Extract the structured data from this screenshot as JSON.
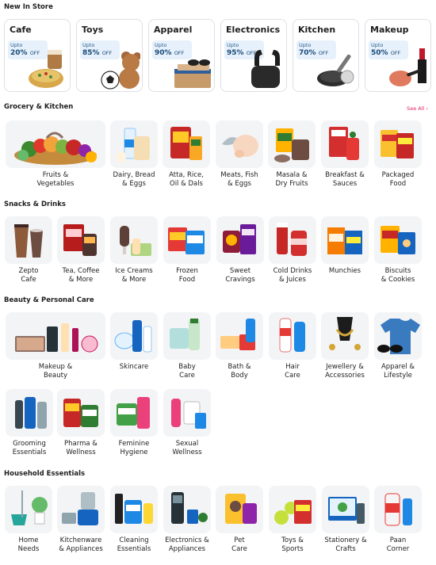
{
  "new_in_store": {
    "title": "New In Store",
    "cards": [
      {
        "name": "Cafe",
        "upto": "Upto",
        "percent": "20%",
        "off": "OFF",
        "icon": "cafe-food-icon"
      },
      {
        "name": "Toys",
        "upto": "Upto",
        "percent": "85%",
        "off": "OFF",
        "icon": "teddy-bear-icon"
      },
      {
        "name": "Apparel",
        "upto": "Upto",
        "percent": "90%",
        "off": "OFF",
        "icon": "clothes-sunglasses-icon"
      },
      {
        "name": "Electronics",
        "upto": "Upto",
        "percent": "95%",
        "off": "OFF",
        "icon": "earbuds-icon"
      },
      {
        "name": "Kitchen",
        "upto": "Upto",
        "percent": "70%",
        "off": "OFF",
        "icon": "pan-icon"
      },
      {
        "name": "Makeup",
        "upto": "Upto",
        "percent": "50%",
        "off": "OFF",
        "icon": "lipstick-icon"
      }
    ]
  },
  "grocery": {
    "title": "Grocery & Kitchen",
    "see_all": "See All ›",
    "items": [
      {
        "label": "Fruits &\nVegetables",
        "icon": "fruits-vegetables-icon"
      },
      {
        "label": "Dairy, Bread\n& Eggs",
        "icon": "dairy-icon"
      },
      {
        "label": "Atta, Rice,\nOil & Dals",
        "icon": "atta-icon"
      },
      {
        "label": "Meats, Fish\n& Eggs",
        "icon": "chicken-icon"
      },
      {
        "label": "Masala &\nDry Fruits",
        "icon": "masala-icon"
      },
      {
        "label": "Breakfast &\nSauces",
        "icon": "cereal-icon"
      },
      {
        "label": "Packaged\nFood",
        "icon": "noodles-icon"
      }
    ]
  },
  "snacks": {
    "title": "Snacks & Drinks",
    "items": [
      {
        "label": "Zepto\nCafe",
        "icon": "coffee-cup-icon"
      },
      {
        "label": "Tea, Coffee\n& More",
        "icon": "tea-box-icon"
      },
      {
        "label": "Ice Creams\n& More",
        "icon": "ice-cream-icon"
      },
      {
        "label": "Frozen\nFood",
        "icon": "frozen-food-icon"
      },
      {
        "label": "Sweet\nCravings",
        "icon": "chocolate-icon"
      },
      {
        "label": "Cold Drinks\n& Juices",
        "icon": "soda-can-icon"
      },
      {
        "label": "Munchies",
        "icon": "chips-icon"
      },
      {
        "label": "Biscuits\n& Cookies",
        "icon": "biscuits-icon"
      }
    ]
  },
  "beauty": {
    "title": "Beauty & Personal Care",
    "items": [
      {
        "label": "Makeup &\nBeauty",
        "icon": "makeup-palette-icon"
      },
      {
        "label": "Skincare",
        "icon": "skincare-bottle-icon"
      },
      {
        "label": "Baby\nCare",
        "icon": "baby-care-icon"
      },
      {
        "label": "Bath &\nBody",
        "icon": "soap-icon"
      },
      {
        "label": "Hair\nCare",
        "icon": "shampoo-icon"
      },
      {
        "label": "Jewellery &\nAccessories",
        "icon": "necklace-icon"
      },
      {
        "label": "Apparel &\nLifestyle",
        "icon": "tshirt-icon"
      },
      {
        "label": "Grooming\nEssentials",
        "icon": "razor-icon"
      },
      {
        "label": "Pharma &\nWellness",
        "icon": "medicine-icon"
      },
      {
        "label": "Feminine\nHygiene",
        "icon": "pads-icon"
      },
      {
        "label": "Sexual\nWellness",
        "icon": "wellness-icon"
      }
    ]
  },
  "household": {
    "title": "Household Essentials",
    "items": [
      {
        "label": "Home\nNeeds",
        "icon": "mop-bucket-icon"
      },
      {
        "label": "Kitchenware\n& Appliances",
        "icon": "mixer-icon"
      },
      {
        "label": "Cleaning\nEssentials",
        "icon": "detergent-icon"
      },
      {
        "label": "Electronics &\nAppliances",
        "icon": "appliance-icon"
      },
      {
        "label": "Pet\nCare",
        "icon": "pet-food-icon"
      },
      {
        "label": "Toys &\nSports",
        "icon": "ball-cards-icon"
      },
      {
        "label": "Stationery &\nCrafts",
        "icon": "puzzle-box-icon"
      },
      {
        "label": "Paan\nCorner",
        "icon": "lighter-icon"
      }
    ]
  },
  "colors": {
    "accent": "#e0245e",
    "offer_bg": "#e6f1fb",
    "offer_text": "#1a4a7a",
    "tile_bg": "#f3f4f6"
  }
}
